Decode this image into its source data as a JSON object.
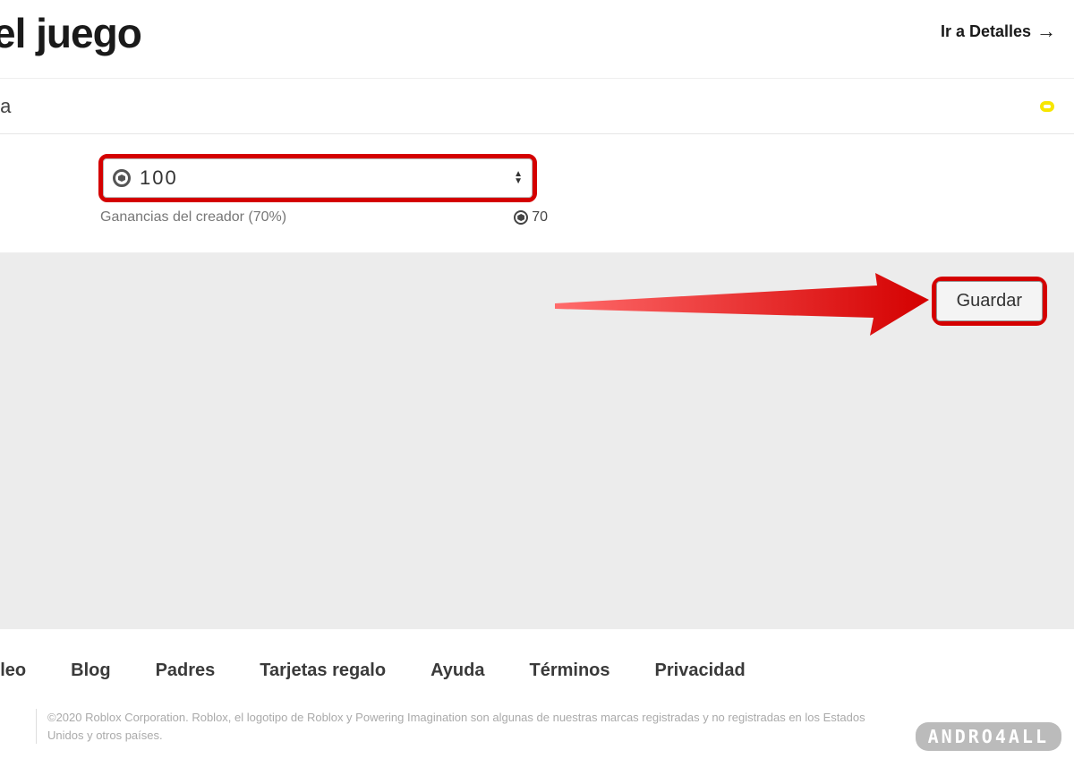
{
  "header": {
    "title_fragment": "el juego",
    "details_link": "Ir a Detalles"
  },
  "sale": {
    "row_label_fragment": "ta",
    "price_value": "100",
    "earnings_label": "Ganancias del creador (70%)",
    "earnings_value": "70"
  },
  "actions": {
    "save": "Guardar"
  },
  "footer": {
    "links": [
      "oleo",
      "Blog",
      "Padres",
      "Tarjetas regalo",
      "Ayuda",
      "Términos",
      "Privacidad"
    ],
    "copyright": "©2020 Roblox Corporation. Roblox, el logotipo de Roblox y Powering Imagination son algunas de nuestras marcas registradas y no registradas en los Estados Unidos y otros países."
  },
  "watermark": "ANDRO4ALL"
}
